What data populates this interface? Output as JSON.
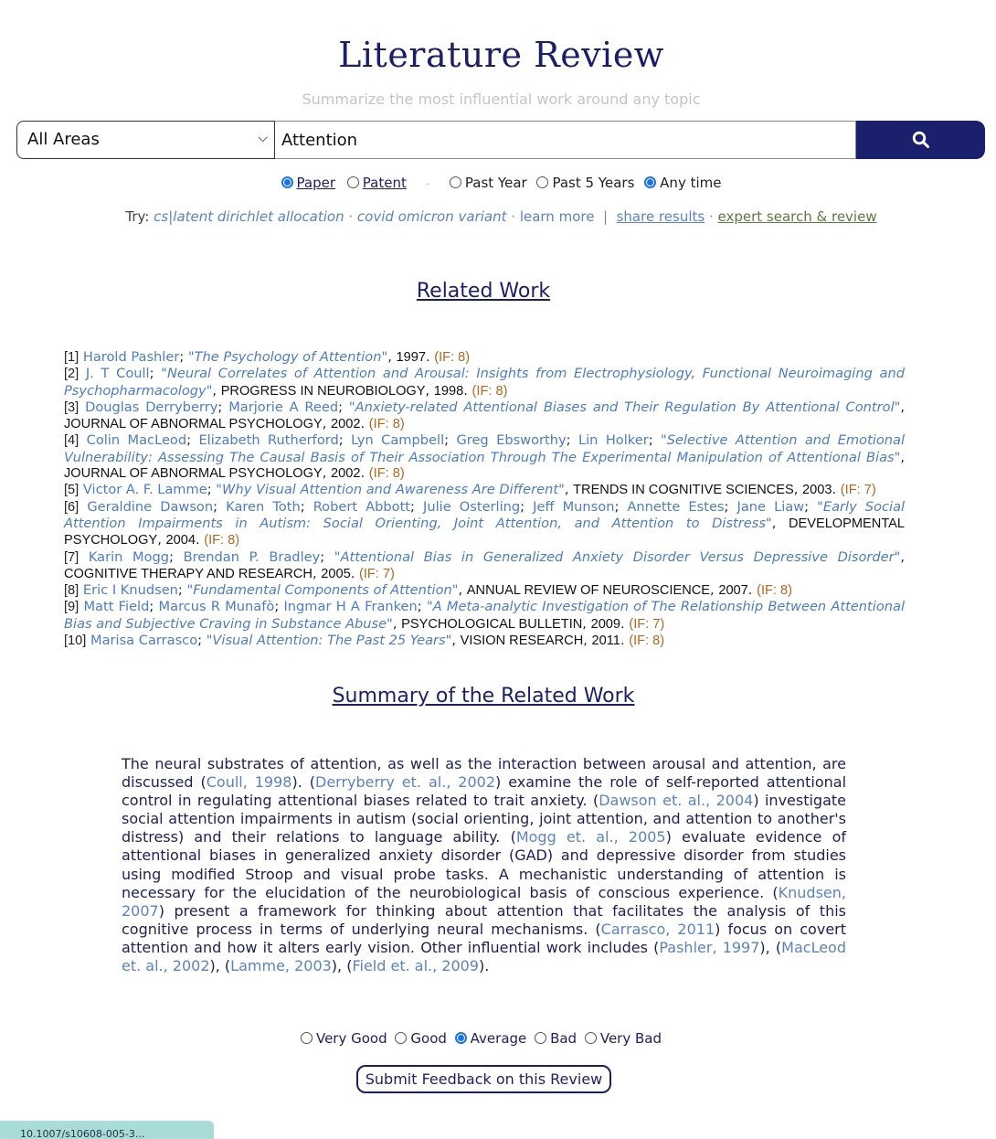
{
  "header": {
    "title": "Literature Review",
    "subtitle": "Summarize the most influential work around any topic"
  },
  "search": {
    "area_selected": "All Areas",
    "query": "Attention",
    "button_icon": "search-icon"
  },
  "filters": {
    "type_options": [
      {
        "label": "Paper",
        "checked": true
      },
      {
        "label": "Patent",
        "checked": false
      }
    ],
    "time_options": [
      {
        "label": "Past Year",
        "checked": false
      },
      {
        "label": "Past 5 Years",
        "checked": false
      },
      {
        "label": "Any time",
        "checked": true
      }
    ]
  },
  "try_bar": {
    "prefix": "Try:",
    "suggestions": [
      "cs|latent dirichlet allocation",
      "covid omicron variant"
    ],
    "learn_more": "learn more",
    "share": "share results",
    "expert": "expert search & review"
  },
  "related_work": {
    "heading": "Related Work",
    "references": [
      {
        "num": "[1]",
        "authors": [
          "Harold Pashler"
        ],
        "title": "\"The Psychology of Attention\"",
        "journal": "",
        "year": "1997",
        "if": "(IF: 8)"
      },
      {
        "num": "[2]",
        "authors": [
          "J. T Coull"
        ],
        "title": "\"Neural Correlates of Attention and Arousal: Insights from Electrophysiology, Functional Neuroimaging and Psychopharmacology\"",
        "journal": "PROGRESS IN NEUROBIOLOGY",
        "year": "1998",
        "if": "(IF: 8)"
      },
      {
        "num": "[3]",
        "authors": [
          "Douglas Derryberry",
          "Marjorie A Reed"
        ],
        "title": "\"Anxiety-related Attentional Biases and Their Regulation By Attentional Control\"",
        "journal": "JOURNAL OF ABNORMAL PSYCHOLOGY",
        "year": "2002",
        "if": "(IF: 8)"
      },
      {
        "num": "[4]",
        "authors": [
          "Colin MacLeod",
          "Elizabeth Rutherford",
          "Lyn Campbell",
          "Greg Ebsworthy",
          "Lin Holker"
        ],
        "title": "\"Selective Attention and Emotional Vulnerability: Assessing The Causal Basis of Their Association Through The Experimental Manipulation of Attentional Bias\"",
        "journal": "JOURNAL OF ABNORMAL PSYCHOLOGY",
        "year": "2002",
        "if": "(IF: 8)"
      },
      {
        "num": "[5]",
        "authors": [
          "Victor A. F. Lamme"
        ],
        "title": "\"Why Visual Attention and Awareness Are Different\"",
        "journal": "TRENDS IN COGNITIVE SCIENCES",
        "year": "2003",
        "if": "(IF: 7)"
      },
      {
        "num": "[6]",
        "authors": [
          "Geraldine Dawson",
          "Karen Toth",
          "Robert Abbott",
          "Julie Osterling",
          "Jeff Munson",
          "Annette Estes",
          "Jane Liaw"
        ],
        "title": "\"Early Social Attention Impairments in Autism: Social Orienting, Joint Attention, and Attention to Distress\"",
        "journal": "DEVELOPMENTAL PSYCHOLOGY",
        "year": "2004",
        "if": "(IF: 8)"
      },
      {
        "num": "[7]",
        "authors": [
          "Karin Mogg",
          "Brendan P. Bradley"
        ],
        "title": "\"Attentional Bias in Generalized Anxiety Disorder Versus Depressive Disorder\"",
        "journal": "COGNITIVE THERAPY AND RESEARCH",
        "year": "2005",
        "if": "(IF: 7)"
      },
      {
        "num": "[8]",
        "authors": [
          "Eric I Knudsen"
        ],
        "title": "\"Fundamental Components of Attention\"",
        "journal": "ANNUAL REVIEW OF NEUROSCIENCE",
        "year": "2007",
        "if": "(IF: 8)"
      },
      {
        "num": "[9]",
        "authors": [
          "Matt Field",
          "Marcus R Munafò",
          "Ingmar H A Franken"
        ],
        "title": "\"A Meta-analytic Investigation of The Relationship Between Attentional Bias and Subjective Craving in Substance Abuse\"",
        "journal": "PSYCHOLOGICAL BULLETIN",
        "year": "2009",
        "if": "(IF: 7)"
      },
      {
        "num": "[10]",
        "authors": [
          "Marisa Carrasco"
        ],
        "title": "\"Visual Attention: The Past 25 Years\"",
        "journal": "VISION RESEARCH",
        "year": "2011",
        "if": "(IF: 8)"
      }
    ]
  },
  "summary": {
    "heading": "Summary of the Related Work",
    "segments": [
      {
        "t": "The neural substrates of attention, as well as the interaction between arousal and attention, are discussed ("
      },
      {
        "c": "Coull, 1998"
      },
      {
        "t": "). ("
      },
      {
        "c": "Derryberry et. al., 2002"
      },
      {
        "t": ") examine the role of self-reported attentional control in regulating attentional biases related to trait anxiety. ("
      },
      {
        "c": "Dawson et. al., 2004"
      },
      {
        "t": ") investigate social attention impairments in autism (social orienting, joint attention, and attention to another's distress) and their relations to language ability. ("
      },
      {
        "c": "Mogg et. al., 2005"
      },
      {
        "t": ") evaluate evidence of attentional biases in generalized anxiety disorder (GAD) and depressive disorder from studies using modified Stroop and visual probe tasks. A mechanistic understanding of attention is necessary for the elucidation of the neurobiological basis of conscious experience. ("
      },
      {
        "c": "Knudsen, 2007"
      },
      {
        "t": ") present a framework for thinking about attention that facilitates the analysis of this cognitive process in terms of underlying neural mechanisms. ("
      },
      {
        "c": "Carrasco, 2011"
      },
      {
        "t": ") focus on covert attention and how it alters early vision. Other influential work includes ("
      },
      {
        "c": "Pashler, 1997"
      },
      {
        "t": "), ("
      },
      {
        "c": "MacLeod et. al., 2002"
      },
      {
        "t": "), ("
      },
      {
        "c": "Lamme, 2003"
      },
      {
        "t": "), ("
      },
      {
        "c": "Field et. al., 2009"
      },
      {
        "t": ")."
      }
    ]
  },
  "feedback": {
    "options": [
      {
        "label": "Very Good",
        "checked": false
      },
      {
        "label": "Good",
        "checked": false
      },
      {
        "label": "Average",
        "checked": true
      },
      {
        "label": "Bad",
        "checked": false
      },
      {
        "label": "Very Bad",
        "checked": false
      }
    ],
    "submit_label": "Submit Feedback on this Review"
  },
  "status_bar": {
    "text": "10.1007/s10608-005-3..."
  },
  "colors": {
    "navy": "#1b1f6b",
    "link": "#4c7cc6",
    "impact": "#b5651d",
    "radio_accent": "#1a73e8"
  }
}
